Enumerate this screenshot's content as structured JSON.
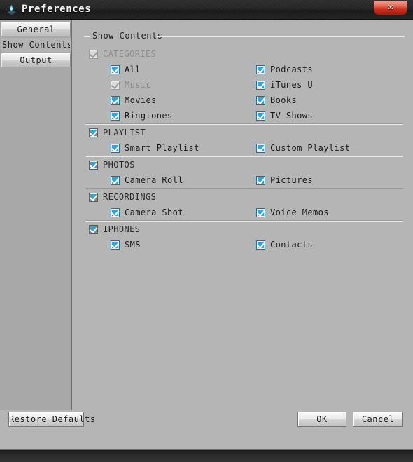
{
  "window": {
    "title": "Preferences",
    "app_icon": "app-icon",
    "close_label": "✕"
  },
  "sidebar": {
    "tabs": [
      {
        "label": "General",
        "selected": false
      },
      {
        "label": "Show Contents",
        "selected": true
      },
      {
        "label": "Output",
        "selected": false
      }
    ]
  },
  "groupbox": {
    "legend": "Show Contents"
  },
  "sections": [
    {
      "name": "categories",
      "header": {
        "label": "CATEGORIES",
        "checked": true,
        "enabled": false
      },
      "rows": [
        {
          "left": {
            "label": "All",
            "checked": true,
            "enabled": true
          },
          "right": {
            "label": "Podcasts",
            "checked": true,
            "enabled": true
          }
        },
        {
          "left": {
            "label": "Music",
            "checked": true,
            "enabled": false
          },
          "right": {
            "label": "iTunes U",
            "checked": true,
            "enabled": true
          }
        },
        {
          "left": {
            "label": "Movies",
            "checked": true,
            "enabled": true
          },
          "right": {
            "label": "Books",
            "checked": true,
            "enabled": true
          }
        },
        {
          "left": {
            "label": "Ringtones",
            "checked": true,
            "enabled": true
          },
          "right": {
            "label": "TV Shows",
            "checked": true,
            "enabled": true
          }
        }
      ]
    },
    {
      "name": "playlist",
      "header": {
        "label": "PLAYLIST",
        "checked": true,
        "enabled": true
      },
      "rows": [
        {
          "left": {
            "label": "Smart Playlist",
            "checked": true,
            "enabled": true
          },
          "right": {
            "label": "Custom Playlist",
            "checked": true,
            "enabled": true
          }
        }
      ]
    },
    {
      "name": "photos",
      "header": {
        "label": "PHOTOS",
        "checked": true,
        "enabled": true
      },
      "rows": [
        {
          "left": {
            "label": "Camera Roll",
            "checked": true,
            "enabled": true
          },
          "right": {
            "label": "Pictures",
            "checked": true,
            "enabled": true
          }
        }
      ]
    },
    {
      "name": "recordings",
      "header": {
        "label": "RECORDINGS",
        "checked": true,
        "enabled": true
      },
      "rows": [
        {
          "left": {
            "label": "Camera Shot",
            "checked": true,
            "enabled": true
          },
          "right": {
            "label": "Voice Memos",
            "checked": true,
            "enabled": true
          }
        }
      ]
    },
    {
      "name": "iphones",
      "header": {
        "label": "IPHONES",
        "checked": true,
        "enabled": true
      },
      "rows": [
        {
          "left": {
            "label": "SMS",
            "checked": true,
            "enabled": true
          },
          "right": {
            "label": "Contacts",
            "checked": true,
            "enabled": true
          }
        }
      ]
    }
  ],
  "buttons": {
    "restore_defaults": "Restore Defaults",
    "ok": "OK",
    "cancel": "Cancel"
  },
  "colors": {
    "dialog_bg": "#b5b5b5",
    "sidebar_bg": "#a8a8a8",
    "titlebar_dark": "#262626",
    "checkbox_accent": "#3ba3d4",
    "close_red": "#c8311c"
  }
}
